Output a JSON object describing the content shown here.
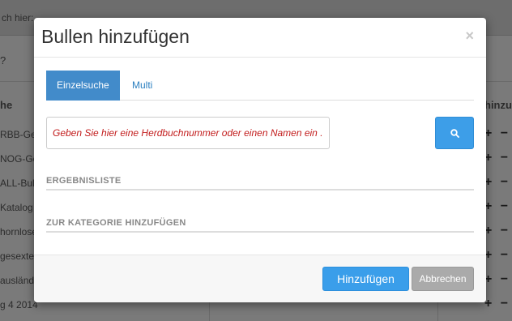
{
  "background": {
    "breadcrumb": "ch hier: ",
    "question_mark": "?",
    "column_header_left": "he",
    "column_header_right": "hinzu",
    "rows": [
      "RBB-Ge",
      "NOG-Ge",
      "ALL-Bulle",
      "Katalog",
      "hornlose",
      "gesexte",
      "ausländ",
      "g 4 2014"
    ],
    "plus_minus": "+ −"
  },
  "modal": {
    "title": "Bullen hinzufügen",
    "close_symbol": "×",
    "tabs": [
      {
        "label": "Einzelsuche",
        "active": true
      },
      {
        "label": "Multi",
        "active": false
      }
    ],
    "search": {
      "placeholder": "Geben Sie hier eine Herdbuchnummer oder einen Namen ein ...",
      "value": ""
    },
    "sections": {
      "results": "ERGEBNISLISTE",
      "add_to_category": "ZUR KATEGORIE HINZUFÜGEN"
    },
    "footer": {
      "primary_label": "Hinzufügen",
      "secondary_label": "Abbrechen"
    }
  },
  "colors": {
    "accent": "#428bca",
    "primary_button": "#3a9eea",
    "placeholder_text": "#c21c1c",
    "secondary_button": "#aaaaaa"
  }
}
